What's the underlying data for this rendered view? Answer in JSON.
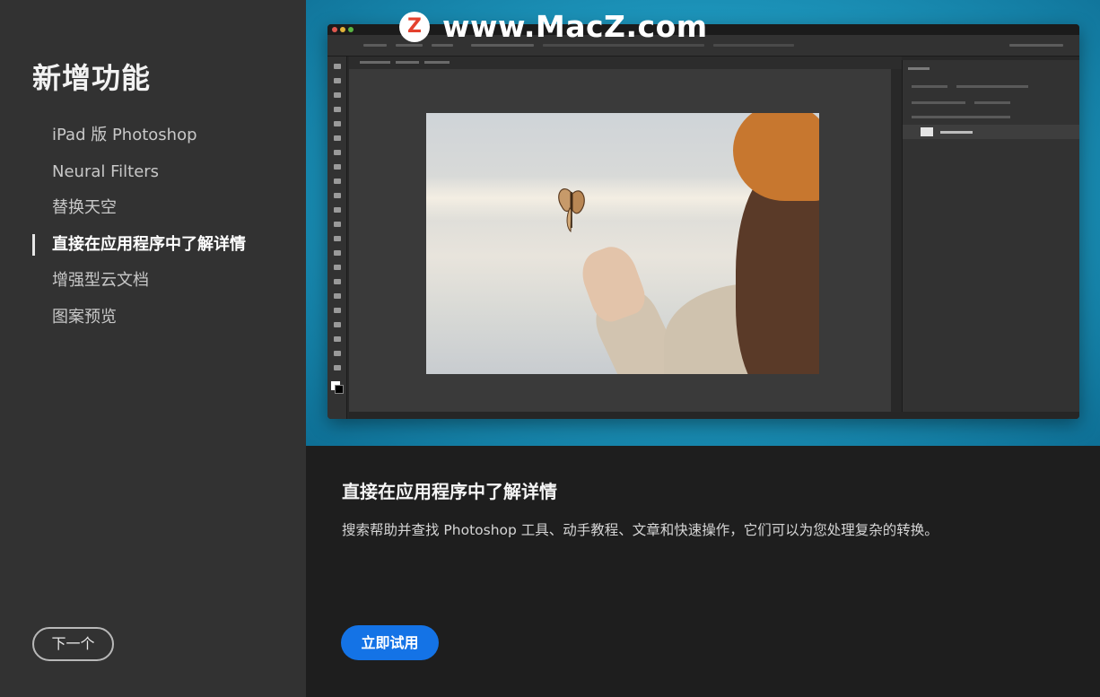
{
  "sidebar": {
    "title": "新增功能",
    "items": [
      {
        "label": "iPad 版 Photoshop"
      },
      {
        "label": "Neural Filters"
      },
      {
        "label": "替换天空"
      },
      {
        "label": "直接在应用程序中了解详情"
      },
      {
        "label": "增强型云文档"
      },
      {
        "label": "图案预览"
      }
    ],
    "active_index": 3,
    "next_label": "下一个"
  },
  "watermark": {
    "logo_letter": "Z",
    "text": "www.MacZ.com"
  },
  "content": {
    "title": "直接在应用程序中了解详情",
    "description": "搜索帮助并查找 Photoshop 工具、动手教程、文章和快速操作，它们可以为您处理复杂的转换。",
    "try_label": "立即试用"
  },
  "colors": {
    "accent": "#1473e6",
    "sidebar_bg": "#323232",
    "main_bg": "#1e1e1e",
    "hero_teal": "#1f9ac0"
  },
  "icons": [
    "photoshop-window-preview-image",
    "butterfly-icon",
    "macz-logo-icon"
  ]
}
